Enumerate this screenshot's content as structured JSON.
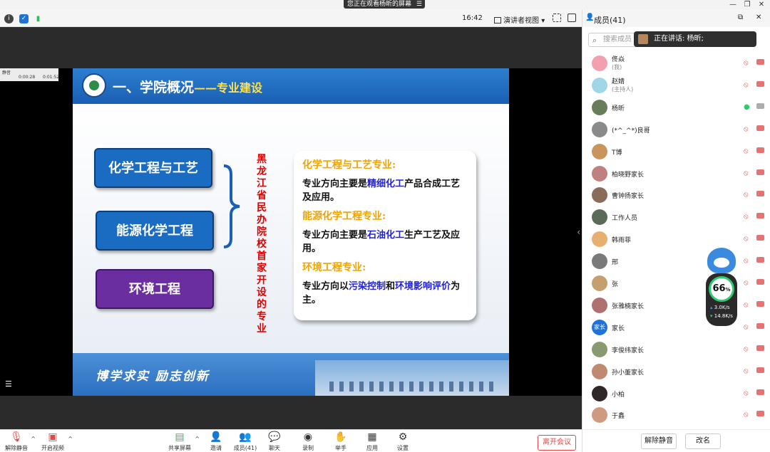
{
  "window": {
    "share_banner": "您正在观看杨昕的屏幕"
  },
  "toolbar": {
    "time": "16:42",
    "presenter_view": "演讲者视图"
  },
  "mini_player": {
    "label": "静音",
    "time_current": "0:00:28",
    "time_total": "0:01:52"
  },
  "slide": {
    "title": "一、学院概况",
    "title_sub": "——专业建设",
    "majors": [
      "化学工程与工艺",
      "能源化学工程",
      "环境工程"
    ],
    "vertical_text": "黑龙江省民办院校首家开设的专业",
    "sections": [
      {
        "heading": "化学工程与工艺专业:",
        "pre": "专业方向主要是",
        "hl1": "精细化工",
        "mid": "产品合成工艺及应用。",
        "hl2": "",
        "post": ""
      },
      {
        "heading": "能源化学工程专业:",
        "pre": "专业方向主要是",
        "hl1": "石油化工",
        "mid": "生产工艺及应用。",
        "hl2": "",
        "post": ""
      },
      {
        "heading": "环境工程专业:",
        "pre": "专业方向以",
        "hl1": "污染控制",
        "mid": "和",
        "hl2": "环境影响评价",
        "post": "为主。"
      }
    ],
    "motto": "博学求实  励志创新"
  },
  "controls": {
    "unmute": "解除静音",
    "start_video": "开启视频",
    "share_screen": "共享屏幕",
    "invite": "邀请",
    "members": "成员(41)",
    "chat": "聊天",
    "record": "录制",
    "raise_hand": "举手",
    "apps": "应用",
    "settings": "设置",
    "leave": "离开会议"
  },
  "panel": {
    "title": "成员(41)",
    "search_placeholder": "搜索成员",
    "speaking_label": "正在讲话: 杨昕;",
    "members": [
      {
        "name": "佟焱",
        "role": "(我)",
        "color": "#f2a0b0"
      },
      {
        "name": "赵婧",
        "role": "(主持人)",
        "color": "#9fd6e8"
      },
      {
        "name": "杨昕",
        "role": "",
        "color": "#6a7d5a"
      },
      {
        "name": "(*^_^*)良哥",
        "role": "",
        "color": "#8a8a8a"
      },
      {
        "name": "T博",
        "role": "",
        "color": "#c9955d"
      },
      {
        "name": "柏晓野家长",
        "role": "",
        "color": "#c08080"
      },
      {
        "name": "曹钟扬家长",
        "role": "",
        "color": "#8a6c5a"
      },
      {
        "name": "工作人员",
        "role": "",
        "color": "#5b6b5a"
      },
      {
        "name": "韩雨菲",
        "role": "",
        "color": "#e8b070"
      },
      {
        "name": "邢",
        "role": "",
        "color": "#7a7a7a"
      },
      {
        "name": "张",
        "role": "",
        "color": "#c4a070"
      },
      {
        "name": "张雅楠家长",
        "role": "",
        "color": "#b07070"
      },
      {
        "name": "家长",
        "role": "",
        "color": "#1e73d8"
      },
      {
        "name": "李俊纬家长",
        "role": "",
        "color": "#8a9a70"
      },
      {
        "name": "孙小董家长",
        "role": "",
        "color": "#c08a70"
      },
      {
        "name": "小柏",
        "role": "",
        "color": "#302828"
      },
      {
        "name": "于鑫",
        "role": "",
        "color": "#d09a80"
      }
    ],
    "avatar_text_jiazhang": "家长",
    "unmute_all": "解除静音",
    "rename": "改名"
  },
  "speed": {
    "value": "66",
    "unit": "%",
    "up": "3.0K/s",
    "down": "14.8K/s"
  }
}
